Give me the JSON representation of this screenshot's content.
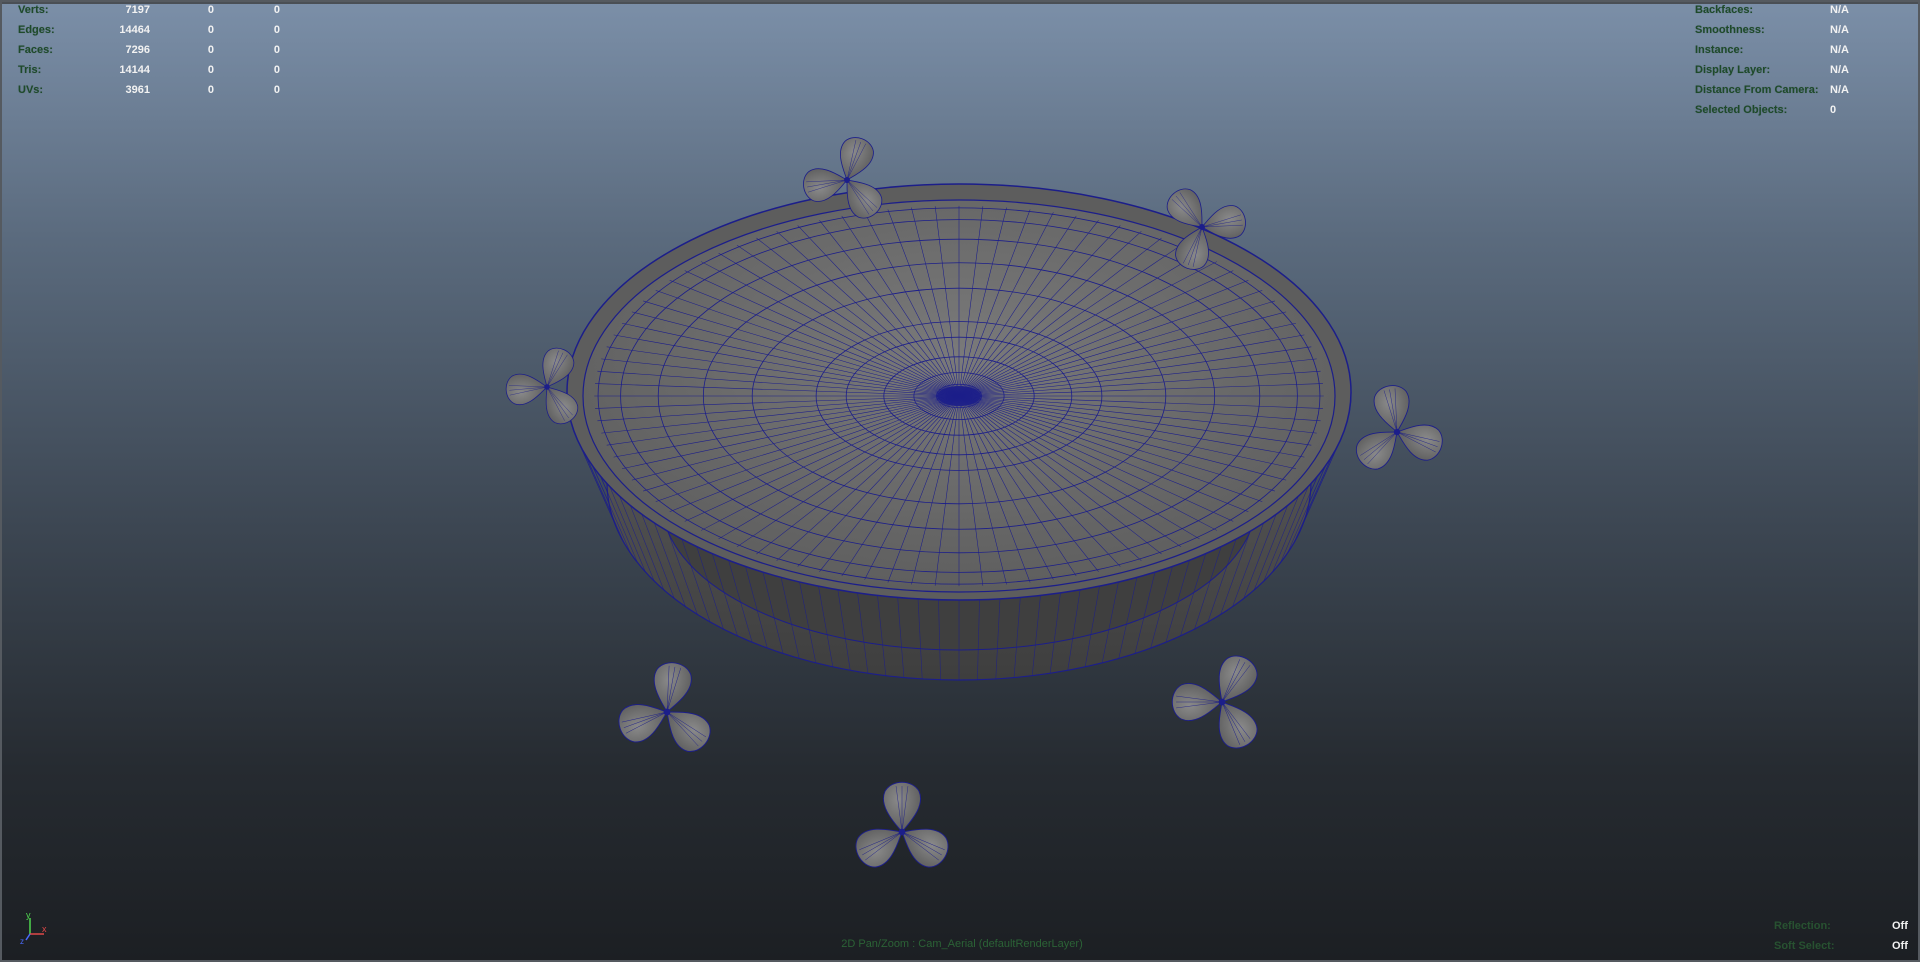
{
  "poly_count": {
    "rows": [
      {
        "label": "Verts:",
        "values": [
          "7197",
          "0",
          "0"
        ]
      },
      {
        "label": "Edges:",
        "values": [
          "14464",
          "0",
          "0"
        ]
      },
      {
        "label": "Faces:",
        "values": [
          "7296",
          "0",
          "0"
        ]
      },
      {
        "label": "Tris:",
        "values": [
          "14144",
          "0",
          "0"
        ]
      },
      {
        "label": "UVs:",
        "values": [
          "3961",
          "0",
          "0"
        ]
      }
    ]
  },
  "object_details": {
    "rows": [
      {
        "label": "Backfaces:",
        "value": "N/A"
      },
      {
        "label": "Smoothness:",
        "value": "N/A"
      },
      {
        "label": "Instance:",
        "value": "N/A"
      },
      {
        "label": "Display Layer:",
        "value": "N/A"
      },
      {
        "label": "Distance From Camera:",
        "value": "N/A"
      },
      {
        "label": "Selected Objects:",
        "value": "0"
      }
    ]
  },
  "viewport_status": {
    "rows": [
      {
        "label": "Reflection:",
        "value": "Off"
      },
      {
        "label": "Soft Select:",
        "value": "Off"
      }
    ]
  },
  "camera_label": "2D Pan/Zoom : Cam_Aerial (defaultRenderLayer)",
  "axis": {
    "x": "x",
    "y": "y",
    "z": "z"
  },
  "colors": {
    "wireframe": "#1c1e8a",
    "surface": "#6f6f6f",
    "label_green": "#1e4a2a",
    "value_white": "#f2f2f2"
  }
}
